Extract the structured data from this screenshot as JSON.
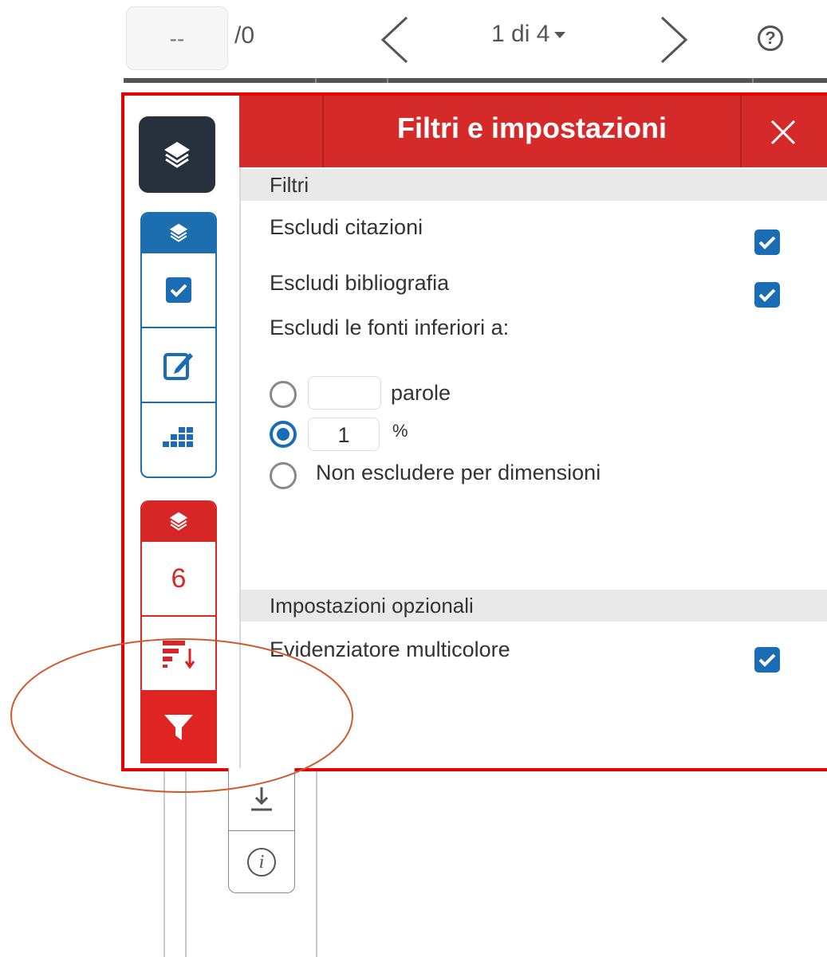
{
  "toolbar": {
    "page_input_value": "--",
    "page_total": "/0",
    "page_indicator": "1 di 4",
    "help_symbol": "?"
  },
  "rail": {
    "match_count": "6"
  },
  "panel": {
    "title": "Filtri e impostazioni",
    "filters_section": "Filtri",
    "exclude_quotes": "Escludi citazioni",
    "exclude_quotes_checked": true,
    "exclude_bibliography": "Escludi bibliografia",
    "exclude_bibliography_checked": true,
    "exclude_sources_label": "Escludi le fonti inferiori a:",
    "words_value": "",
    "words_label": "parole",
    "percent_value": "1",
    "percent_label": "%",
    "no_size_exclusion_label": "Non escludere per dimensioni",
    "selected_option": "percent",
    "optional_section": "Impostazioni opzionali",
    "multicolor_highlighter": "Evidenziatore multicolore",
    "multicolor_highlighter_checked": true
  },
  "colors": {
    "brand_red": "#d42a2a",
    "brand_blue": "#1a6cb4",
    "rail_dark": "#27303d",
    "annotation": "#e60000"
  },
  "icons": {
    "layers": "layers-icon",
    "checkbox": "checkbox-icon",
    "edit": "edit-icon",
    "grid": "grid-icon",
    "sort": "sort-icon",
    "filter": "filter-icon",
    "download": "download-icon",
    "info": "info-icon",
    "close": "close-icon"
  }
}
